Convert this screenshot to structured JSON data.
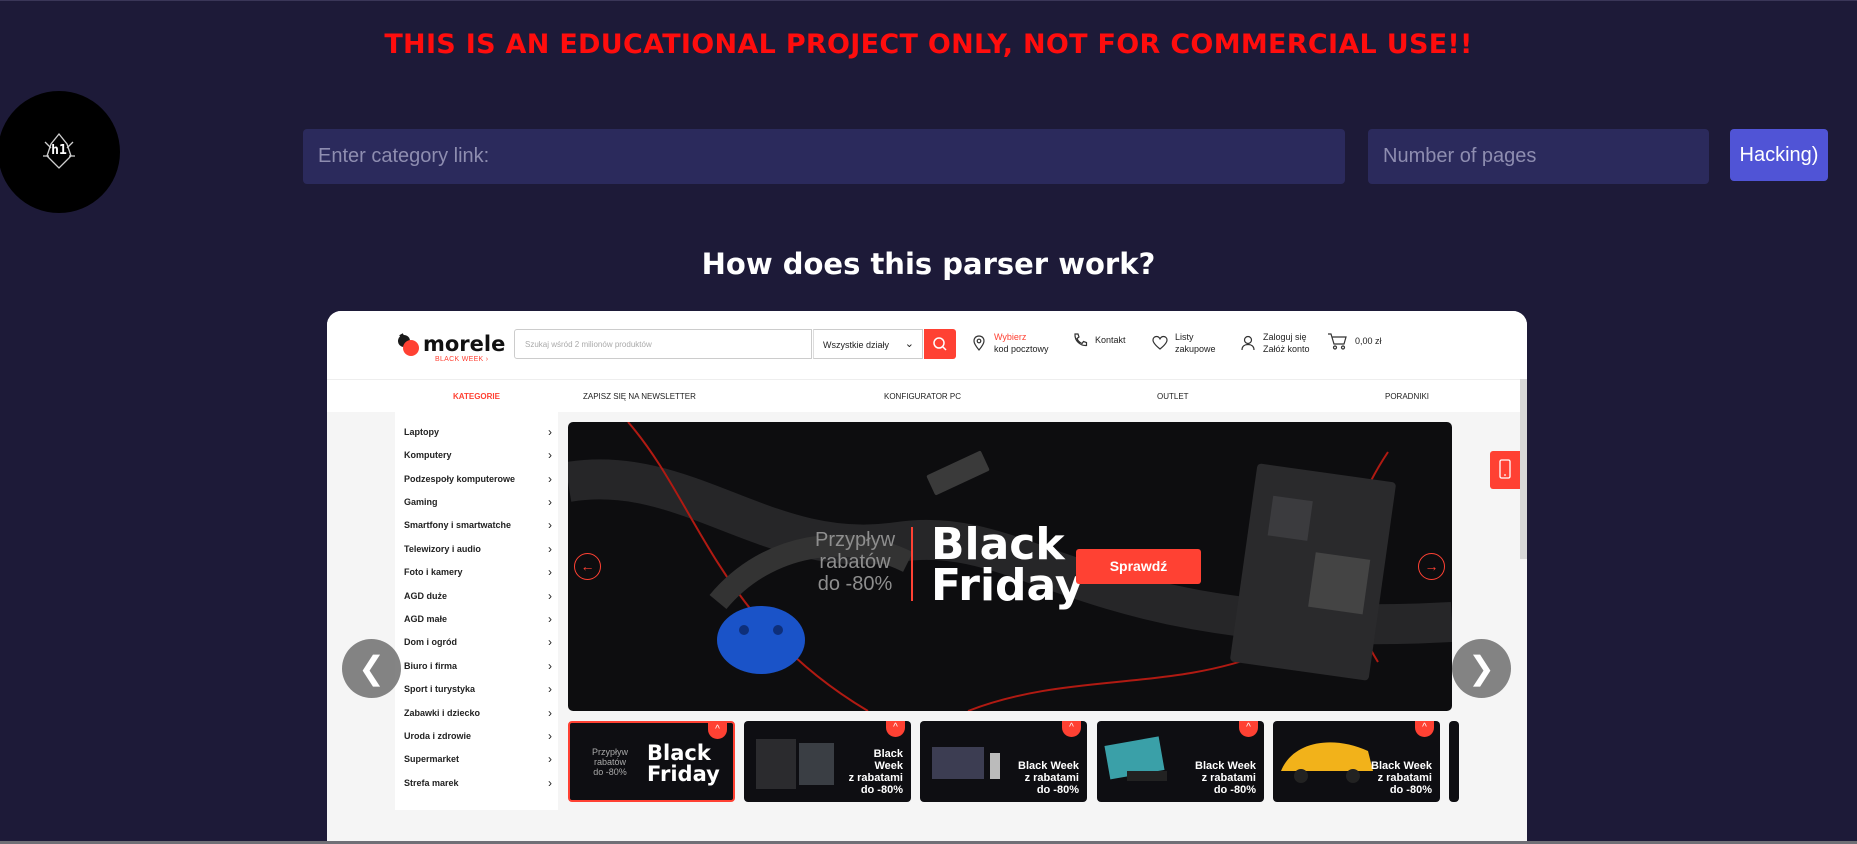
{
  "warning": "THIS IS AN EDUCATIONAL PROJECT ONLY, NOT FOR COMMERCIAL USE!!",
  "logo": {
    "text": "h1",
    "icon": "warrior-helmet-icon"
  },
  "form": {
    "link_placeholder": "Enter category link:",
    "link_value": "",
    "pages_placeholder": "Number of pages",
    "pages_value": "",
    "submit_label": "Hacking)"
  },
  "how_title": "How does this parser work?",
  "carousel": {
    "prev_label": "❮",
    "next_label": "❯"
  },
  "shop": {
    "logo_name": "morele",
    "logo_sub": "BLACK WEEK ›",
    "search_placeholder": "Szukaj wśród 2 milionów produktów",
    "department": "Wszystkie działy",
    "nav": {
      "location_line1": "Wybierz",
      "location_line2": "kod pocztowy",
      "contact": "Kontakt",
      "lists_line1": "Listy",
      "lists_line2": "zakupowe",
      "account_line1": "Zaloguj się",
      "account_line2": "Załóż konto",
      "cart": "0,00 zł"
    },
    "menu": {
      "categories": "KATEGORIE",
      "newsletter": "ZAPISZ SIĘ NA NEWSLETTER",
      "configurator": "KONFIGURATOR PC",
      "outlet": "OUTLET",
      "guides": "PORADNIKI"
    },
    "categories": [
      "Laptopy",
      "Komputery",
      "Podzespoły komputerowe",
      "Gaming",
      "Smartfony i smartwatche",
      "Telewizory i audio",
      "Foto i kamery",
      "AGD duże",
      "AGD małe",
      "Dom i ogród",
      "Biuro i firma",
      "Sport i turystyka",
      "Zabawki i dziecko",
      "Uroda i zdrowie",
      "Supermarket",
      "Strefa marek"
    ],
    "banner": {
      "przyplyw": "Przypływ rabatów do -80%",
      "line1": "Przypływ",
      "line2": "rabatów",
      "line3": "do -80%",
      "black": "Black",
      "friday": "Friday",
      "button": "Sprawdź"
    },
    "thumbs": [
      {
        "type": "bf",
        "p1": "Przypływ",
        "p2": "rabatów",
        "p3": "do -80%",
        "big1": "Black",
        "big2": "Friday"
      },
      {
        "type": "bw",
        "l1": "Black",
        "l2": "Week",
        "l3": "z rabatami",
        "l4": "do -80%"
      },
      {
        "type": "bw",
        "l1": "Black Week",
        "l2": "z rabatami",
        "l3": "do -80%"
      },
      {
        "type": "bw",
        "l1": "Black Week",
        "l2": "z rabatami",
        "l3": "do -80%"
      },
      {
        "type": "bw",
        "l1": "Black Week",
        "l2": "z rabatami",
        "l3": "do -80%"
      }
    ]
  },
  "colors": {
    "background": "#1d1a38",
    "warning": "#ff0d0d",
    "input": "#2b2a5c",
    "button": "#5054d6",
    "shop_accent": "#ff4133"
  }
}
